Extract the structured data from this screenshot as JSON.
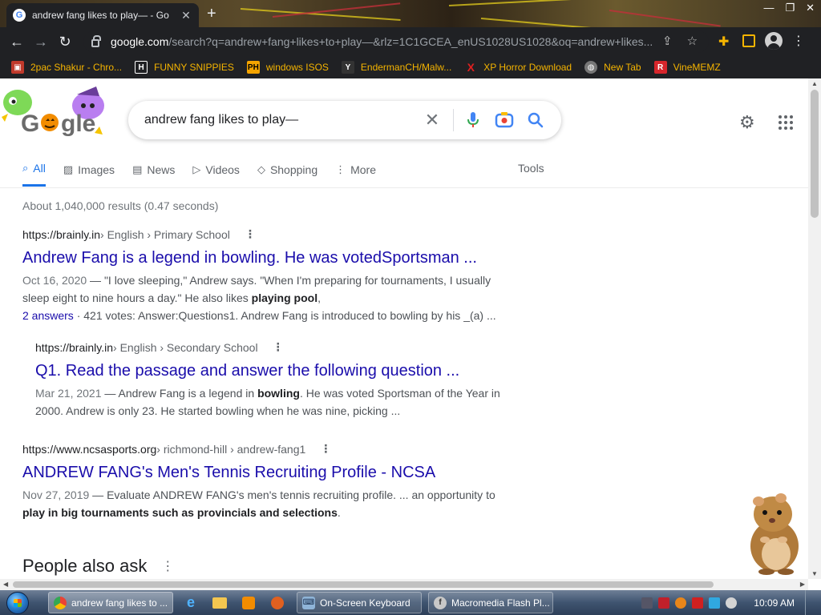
{
  "browser": {
    "tab_title": "andrew fang likes to play— - Go",
    "url_host": "google.com",
    "url_path": "/search?q=andrew+fang+likes+to+play—&rlz=1C1GCEA_enUS1028US1028&oq=andrew+likes...",
    "bookmarks": [
      {
        "label": "2pac Shakur - Chro...",
        "icon": "music-icon",
        "color": "#c0392b"
      },
      {
        "label": "FUNNY SNIPPIES",
        "icon": "h-icon",
        "color": "#202124"
      },
      {
        "label": "windows ISOS",
        "icon": "ph-icon",
        "color": "#f5a400"
      },
      {
        "label": "EndermanCH/Malw...",
        "icon": "yp-icon",
        "color": "#333333"
      },
      {
        "label": "XP Horror Download",
        "icon": "x-icon",
        "color": "#e02020"
      },
      {
        "label": "New Tab",
        "icon": "globe-icon",
        "color": "#777777"
      },
      {
        "label": "VineMEMZ",
        "icon": "r-icon",
        "color": "#d7262c"
      }
    ]
  },
  "search": {
    "query": "andrew fang likes to play—",
    "tabs": [
      {
        "label": "All",
        "icon": "search-icon",
        "active": true
      },
      {
        "label": "Images",
        "icon": "image-icon"
      },
      {
        "label": "News",
        "icon": "news-icon"
      },
      {
        "label": "Videos",
        "icon": "video-icon"
      },
      {
        "label": "Shopping",
        "icon": "tag-icon"
      },
      {
        "label": "More",
        "icon": "more-icon"
      }
    ],
    "tools_label": "Tools",
    "stats": "About 1,040,000 results (0.47 seconds)"
  },
  "results": [
    {
      "site": "https://brainly.in",
      "path": " › English › Primary School",
      "title": "Andrew Fang is a legend in bowling. He was votedSportsman ...",
      "date": "Oct 16, 2020",
      "snippet_pre": " — \"I love sleeping,\" Andrew says. \"When I'm preparing for tournaments, I usually sleep eight to nine hours a day.\" He also likes ",
      "snippet_bold": "playing pool",
      "snippet_post": ",",
      "meta_link": "2 answers",
      "meta_rest": " · 421 votes: Answer:Questions1. Andrew Fang is introduced to bowling by his _(a) ..."
    },
    {
      "site": "https://brainly.in",
      "path": " › English › Secondary School",
      "title": "Q1. Read the passage and answer the following question ...",
      "date": "Mar 21, 2021",
      "snippet_pre": " — Andrew Fang is a legend in ",
      "snippet_bold": "bowling",
      "snippet_post": ". He was voted Sportsman of the Year in 2000. Andrew is only 23. He started bowling when he was nine, picking ..."
    },
    {
      "site": "https://www.ncsasports.org",
      "path": " › richmond-hill › andrew-fang1",
      "title": "ANDREW FANG's Men's Tennis Recruiting Profile - NCSA",
      "date": "Nov 27, 2019",
      "snippet_pre": " — Evaluate ANDREW FANG's men's tennis recruiting profile. ... an opportunity to ",
      "snippet_bold": "play in big tournaments such as provincials and selections",
      "snippet_post": "."
    }
  ],
  "people_also_ask": "People also ask",
  "taskbar": {
    "items": [
      {
        "label": "andrew fang likes to ...",
        "icon": "chrome-icon",
        "active": true
      },
      {
        "label": "On-Screen Keyboard",
        "icon": "keyboard-icon"
      },
      {
        "label": "Macromedia Flash Pl...",
        "icon": "flash-icon"
      }
    ],
    "clock": "10:09 AM"
  }
}
